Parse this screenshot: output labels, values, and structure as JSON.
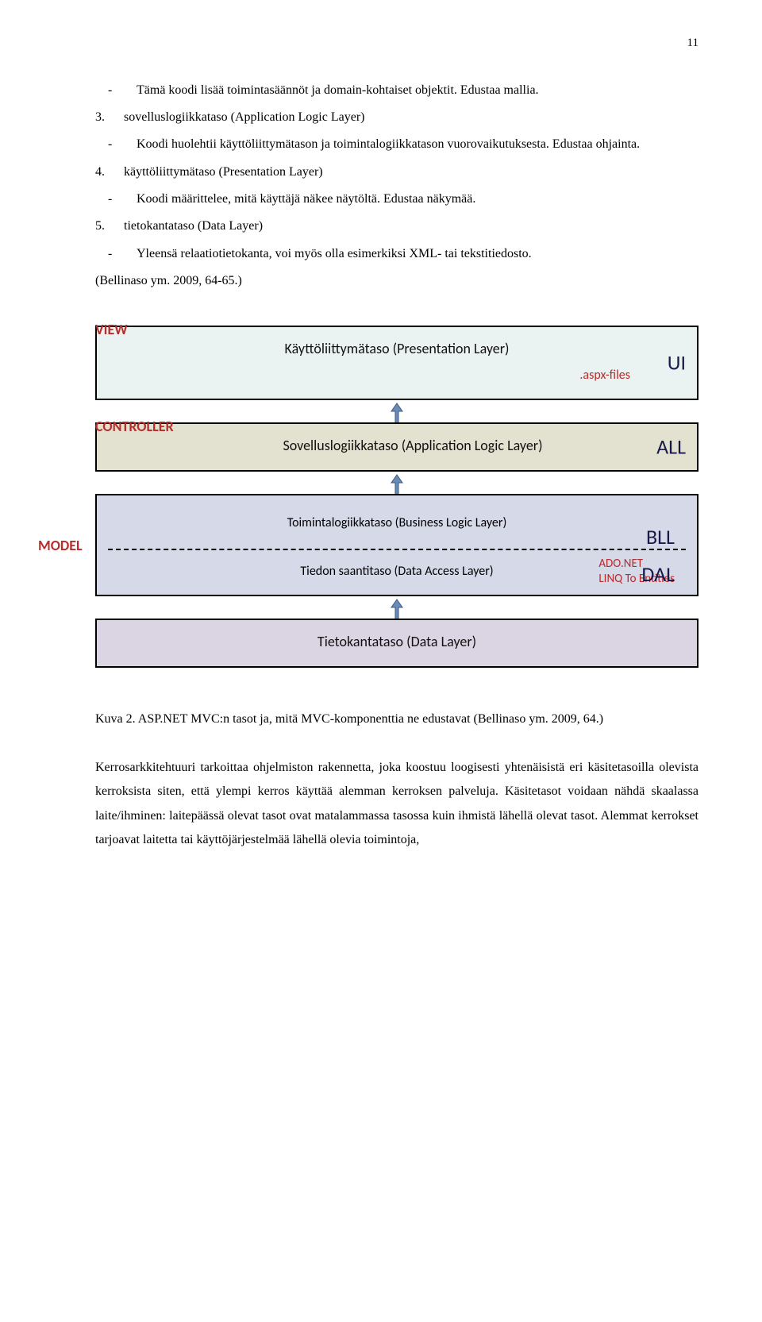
{
  "page_number": "11",
  "list": {
    "dash_item": "Tämä koodi lisää toimintasäännöt ja domain-kohtaiset objektit. Edustaa mallia.",
    "item3_title": "sovelluslogiikkataso (Application Logic Layer)",
    "item3_dash": "Koodi huolehtii käyttöliittymätason ja toimintalogiikkatason vuorovaikutuksesta. Edustaa ohjainta.",
    "item4_title": "käyttöliittymätaso (Presentation Layer)",
    "item4_dash": "Koodi määrittelee, mitä käyttäjä näkee näytöltä. Edustaa näkymää.",
    "item5_title": "tietokantataso (Data Layer)",
    "item5_dash": "Yleensä relaatiotietokanta, voi myös olla esimerkiksi XML- tai tekstitiedosto.",
    "cite": "(Bellinaso ym. 2009, 64-65.)"
  },
  "diagram": {
    "view": {
      "left": "VIEW",
      "main": "Käyttöliittymätaso (Presentation Layer)",
      "sub": ".aspx-files",
      "abbr": "UI"
    },
    "controller": {
      "left": "CONTROLLER",
      "main": "Sovelluslogiikkataso (Application Logic Layer)",
      "abbr": "ALL"
    },
    "model": {
      "side": "MODEL",
      "top_main": "Toimintalogiikkataso (Business Logic Layer)",
      "top_abbr": "BLL",
      "bottom_main": "Tiedon saantitaso (Data Access Layer)",
      "bottom_red1": "ADO.NET",
      "bottom_red2": "LINQ To Entities",
      "bottom_abbr": "DAL"
    },
    "data": {
      "main": "Tietokantataso (Data Layer)"
    }
  },
  "caption": "Kuva 2. ASP.NET MVC:n tasot ja, mitä MVC-komponenttia ne edustavat (Bellinaso ym. 2009, 64.)",
  "para": "Kerrosarkkitehtuuri tarkoittaa ohjelmiston rakennetta, joka koostuu loogisesti yhtenäisistä eri käsitetasoilla olevista kerroksista siten, että ylempi kerros käyttää alemman kerroksen palveluja. Käsitetasot voidaan nähdä skaalassa laite/ihminen: laitepäässä olevat tasot ovat matalammassa tasossa kuin ihmistä lähellä olevat tasot. Alemmat kerrokset tarjoavat laitetta tai käyttöjärjestelmää lähellä olevia toimintoja,"
}
